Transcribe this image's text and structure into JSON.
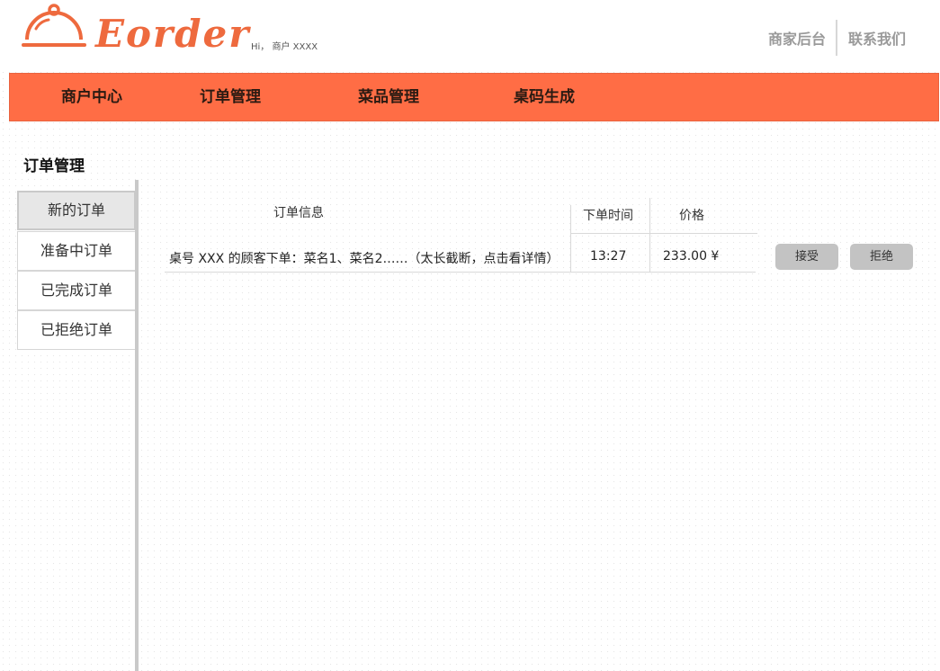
{
  "header": {
    "logo_text": "Eorder",
    "greeting": "Hi， 商户 XXXX",
    "links": [
      "商家后台",
      "联系我们"
    ]
  },
  "nav": [
    "商户中心",
    "订单管理",
    "菜品管理",
    "桌码生成"
  ],
  "page_title": "订单管理",
  "sidebar": [
    "新的订单",
    "准备中订单",
    "已完成订单",
    "已拒绝订单"
  ],
  "table": {
    "headers": [
      "订单信息",
      "下单时间",
      "价格"
    ],
    "rows": [
      {
        "info": "桌号 XXX 的顾客下单：菜名1、菜名2……（太长截断，点击看详情）",
        "time": "13:27",
        "price": "233.00 ¥",
        "accept_label": "接受",
        "reject_label": "拒绝"
      }
    ]
  },
  "colors": {
    "accent": "#ff6d45",
    "logo": "#ee6a3e",
    "button": "#c3c3c3"
  },
  "icons": {
    "logo": "cloche-icon"
  }
}
